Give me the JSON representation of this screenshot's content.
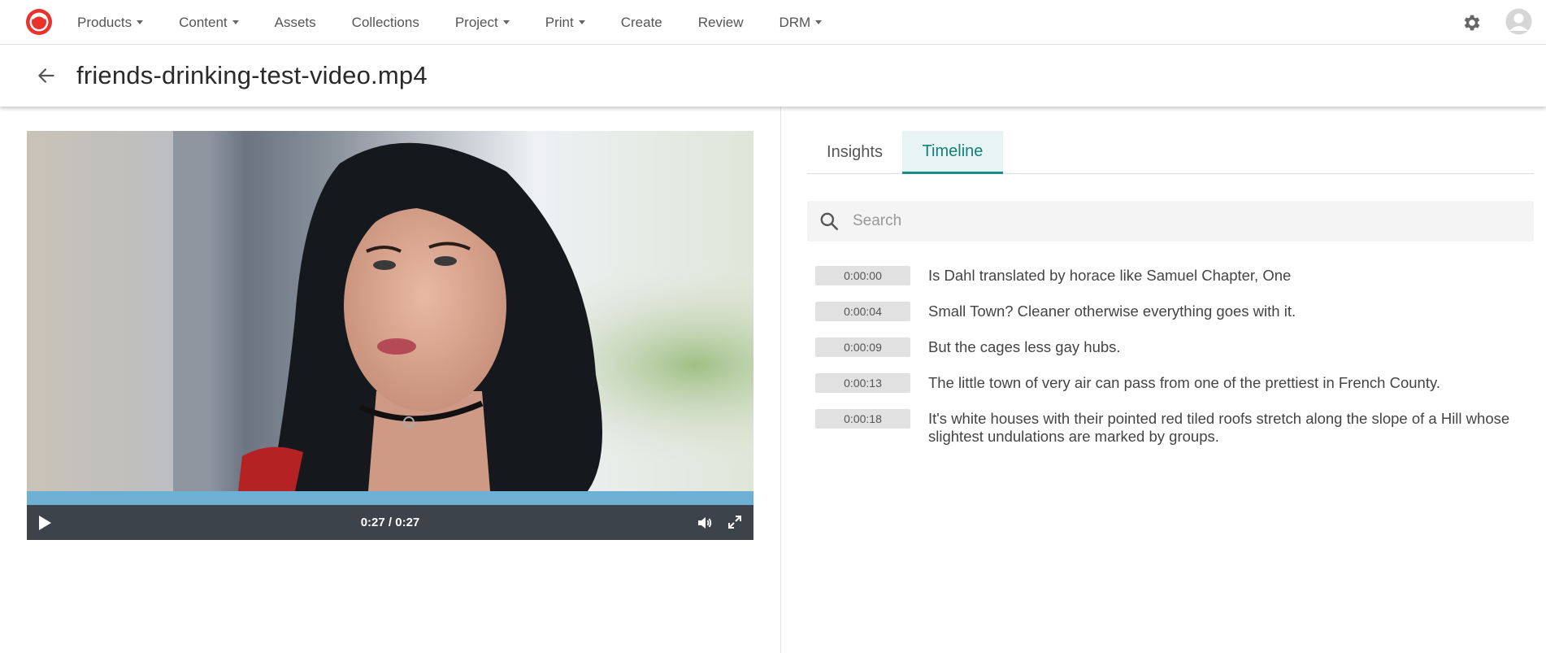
{
  "nav": {
    "items": [
      {
        "label": "Products",
        "dropdown": true
      },
      {
        "label": "Content",
        "dropdown": true
      },
      {
        "label": "Assets",
        "dropdown": false
      },
      {
        "label": "Collections",
        "dropdown": false
      },
      {
        "label": "Project",
        "dropdown": true
      },
      {
        "label": "Print",
        "dropdown": true
      },
      {
        "label": "Create",
        "dropdown": false
      },
      {
        "label": "Review",
        "dropdown": false
      },
      {
        "label": "DRM",
        "dropdown": true
      }
    ],
    "icons": {
      "logo": "brand-logo-icon",
      "settings": "gear-icon",
      "account": "avatar-icon"
    }
  },
  "header": {
    "title": "friends-drinking-test-video.mp4",
    "back_icon": "arrow-left-icon"
  },
  "player": {
    "time": "0:27 / 0:27",
    "progress": 1.0,
    "icons": {
      "play": "play-icon",
      "volume": "volume-icon",
      "fullscreen": "fullscreen-icon"
    }
  },
  "tabs": [
    {
      "label": "Insights",
      "active": false
    },
    {
      "label": "Timeline",
      "active": true
    }
  ],
  "search": {
    "placeholder": "Search",
    "value": ""
  },
  "timeline": [
    {
      "time": "0:00:00",
      "text": "Is Dahl translated by horace like Samuel Chapter, One"
    },
    {
      "time": "0:00:04",
      "text": "Small Town? Cleaner otherwise everything goes with it."
    },
    {
      "time": "0:00:09",
      "text": "But the cages less gay hubs."
    },
    {
      "time": "0:00:13",
      "text": "The little town of very air can pass from one of the prettiest in French County."
    },
    {
      "time": "0:00:18",
      "text": "It's white houses with their pointed red tiled roofs stretch along the slope of a Hill whose slightest undulations are marked by groups."
    }
  ],
  "colors": {
    "brand": "#e8322b",
    "accent_teal": "#137f7a",
    "tab_active_bg": "#e8f3f3",
    "progress": "#6eb0d4",
    "controls_bg": "#3d434a"
  }
}
